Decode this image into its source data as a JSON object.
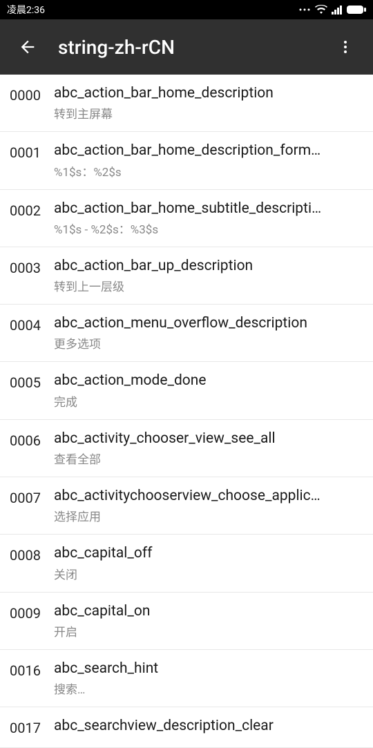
{
  "status_bar": {
    "time": "凌晨2:36"
  },
  "app_bar": {
    "title": "string-zh-rCN"
  },
  "rows": [
    {
      "index": "0000",
      "key": "abc_action_bar_home_description",
      "value": "转到主屏幕"
    },
    {
      "index": "0001",
      "key": "abc_action_bar_home_description_form…",
      "value": "%1$s：%2$s"
    },
    {
      "index": "0002",
      "key": "abc_action_bar_home_subtitle_descripti…",
      "value": "%1$s - %2$s：%3$s"
    },
    {
      "index": "0003",
      "key": "abc_action_bar_up_description",
      "value": "转到上一层级"
    },
    {
      "index": "0004",
      "key": "abc_action_menu_overflow_description",
      "value": "更多选项"
    },
    {
      "index": "0005",
      "key": "abc_action_mode_done",
      "value": "完成"
    },
    {
      "index": "0006",
      "key": "abc_activity_chooser_view_see_all",
      "value": "查看全部"
    },
    {
      "index": "0007",
      "key": "abc_activitychooserview_choose_applic…",
      "value": "选择应用"
    },
    {
      "index": "0008",
      "key": "abc_capital_off",
      "value": "关闭"
    },
    {
      "index": "0009",
      "key": "abc_capital_on",
      "value": "开启"
    },
    {
      "index": "0016",
      "key": "abc_search_hint",
      "value": "搜索…"
    },
    {
      "index": "0017",
      "key": "abc_searchview_description_clear",
      "value": ""
    }
  ]
}
